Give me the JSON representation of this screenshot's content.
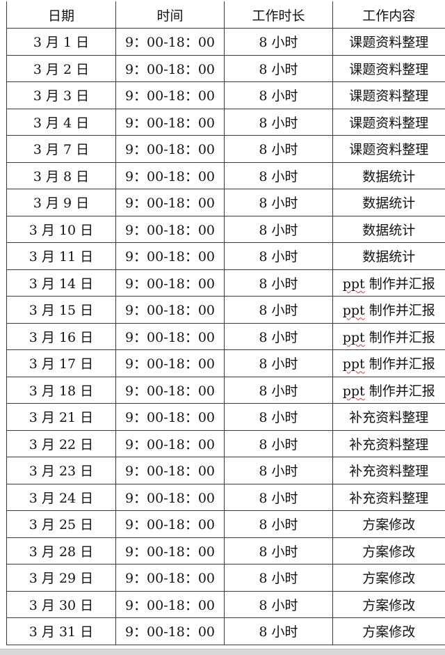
{
  "table": {
    "headers": {
      "date": "日期",
      "time": "时间",
      "hours": "工作时长",
      "task": "工作内容"
    },
    "rows": [
      {
        "date": "3 月 1 日",
        "time": "9：00-18：00",
        "hours": "8 小时",
        "task": "课题资料整理"
      },
      {
        "date": "3 月 2 日",
        "time": "9：00-18：00",
        "hours": "8 小时",
        "task": "课题资料整理"
      },
      {
        "date": "3 月 3 日",
        "time": "9：00-18：00",
        "hours": "8 小时",
        "task": "课题资料整理"
      },
      {
        "date": "3 月 4 日",
        "time": "9：00-18：00",
        "hours": "8 小时",
        "task": "课题资料整理"
      },
      {
        "date": "3 月 7 日",
        "time": "9：00-18：00",
        "hours": "8 小时",
        "task": "课题资料整理"
      },
      {
        "date": "3 月 8 日",
        "time": "9：00-18：00",
        "hours": "8 小时",
        "task": "数据统计"
      },
      {
        "date": "3 月 9 日",
        "time": "9：00-18：00",
        "hours": "8 小时",
        "task": "数据统计"
      },
      {
        "date": "3 月 10 日",
        "time": "9：00-18：00",
        "hours": "8 小时",
        "task": "数据统计"
      },
      {
        "date": "3 月 11 日",
        "time": "9：00-18：00",
        "hours": "8 小时",
        "task": "数据统计"
      },
      {
        "date": "3 月 14 日",
        "time": "9：00-18：00",
        "hours": "8 小时",
        "task_prefix": "ppt",
        "task": " 制作并汇报"
      },
      {
        "date": "3 月 15 日",
        "time": "9：00-18：00",
        "hours": "8 小时",
        "task_prefix": "ppt",
        "task": " 制作并汇报"
      },
      {
        "date": "3 月 16 日",
        "time": "9：00-18：00",
        "hours": "8 小时",
        "task_prefix": "ppt",
        "task": " 制作并汇报"
      },
      {
        "date": "3 月 17 日",
        "time": "9：00-18：00",
        "hours": "8 小时",
        "task_prefix": "ppt",
        "task": " 制作并汇报"
      },
      {
        "date": "3 月 18 日",
        "time": "9：00-18：00",
        "hours": "8 小时",
        "task_prefix": "ppt",
        "task": " 制作并汇报"
      },
      {
        "date": "3 月 21 日",
        "time": "9：00-18：00",
        "hours": "8 小时",
        "task": "补充资料整理"
      },
      {
        "date": "3 月 22 日",
        "time": "9：00-18：00",
        "hours": "8 小时",
        "task": "补充资料整理"
      },
      {
        "date": "3 月 23 日",
        "time": "9：00-18：00",
        "hours": "8 小时",
        "task": "补充资料整理"
      },
      {
        "date": "3 月 24 日",
        "time": "9：00-18：00",
        "hours": "8 小时",
        "task": "补充资料整理"
      },
      {
        "date": "3 月 25 日",
        "time": "9：00-18：00",
        "hours": "8 小时",
        "task": "方案修改"
      },
      {
        "date": "3 月 28 日",
        "time": "9：00-18：00",
        "hours": "8 小时",
        "task": "方案修改"
      },
      {
        "date": "3 月 29 日",
        "time": "9：00-18：00",
        "hours": "8 小时",
        "task": "方案修改"
      },
      {
        "date": "3 月 30 日",
        "time": "9：00-18：00",
        "hours": "8 小时",
        "task": "方案修改"
      },
      {
        "date": "3 月 31 日",
        "time": "9：00-18：00",
        "hours": "8 小时",
        "task": "方案修改"
      }
    ]
  },
  "colors": {
    "border": "#3a3a3a",
    "text": "#111111",
    "spellcheck_underline": "#d23a3a",
    "page_gap": "#d9d9d9"
  }
}
